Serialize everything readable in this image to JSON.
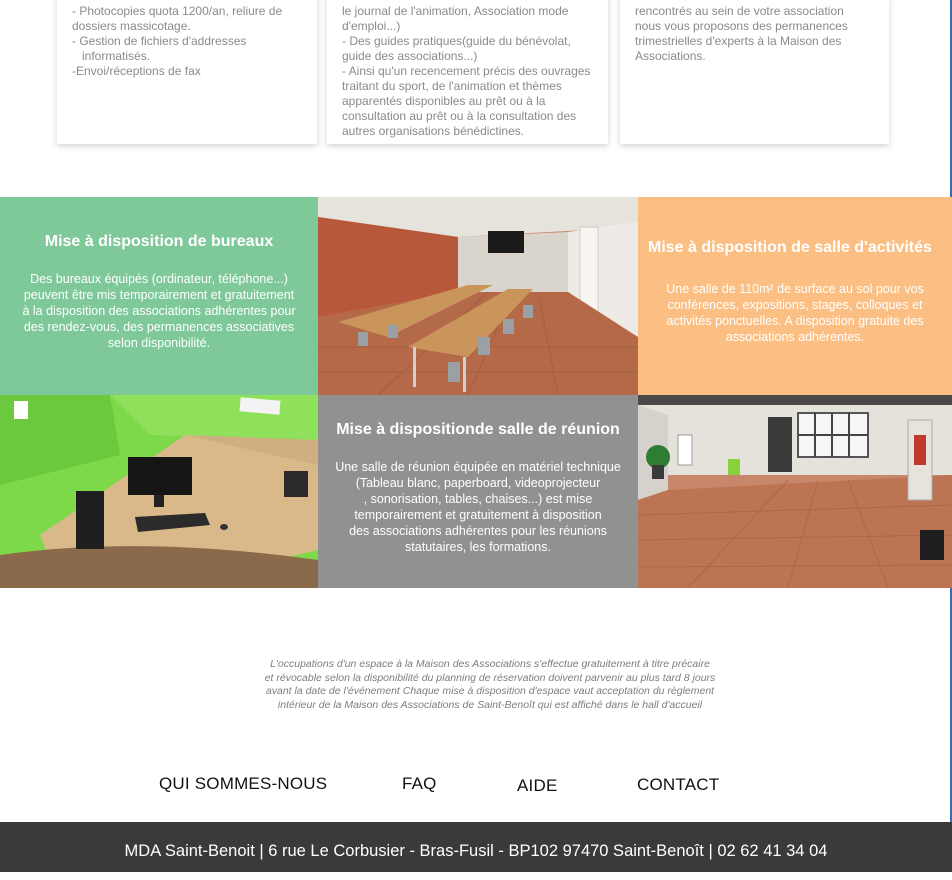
{
  "cards": [
    {
      "lines": [
        {
          "text": "- Photocopies quota 1200/an, reliure de",
          "indent": false
        },
        {
          "text": "dossiers massicotage.",
          "indent": false
        },
        {
          "text": "- Gestion de fichiers d'addresses",
          "indent": false
        },
        {
          "text": "informatisés.",
          "indent": true
        },
        {
          "text": "-Envoi/réceptions de fax",
          "indent": false
        }
      ]
    },
    {
      "lines": [
        {
          "text": "le journal de l'animation, Association mode",
          "indent": false
        },
        {
          "text": "d'emploi...)",
          "indent": false
        },
        {
          "text": "- Des guides pratiques(guide du bénévolat,",
          "indent": false
        },
        {
          "text": "guide des associations...)",
          "indent": false
        },
        {
          "text": "- Ainsi qu'un recencement précis des ouvrages",
          "indent": false
        },
        {
          "text": "traitant du sport, de l'animation et thèmes",
          "indent": false
        },
        {
          "text": "apparentés disponibles au prêt ou à la",
          "indent": false
        },
        {
          "text": "consultation au prêt ou à la consultation des",
          "indent": false
        },
        {
          "text": "autres organisations bénédictines.",
          "indent": false
        }
      ]
    },
    {
      "lines": [
        {
          "text": "rencontrés au sein de votre association",
          "indent": false
        },
        {
          "text": "nous vous proposons des permanences",
          "indent": false
        },
        {
          "text": "trimestrielles d'experts à la Maison  des",
          "indent": false
        },
        {
          "text": "Associations.",
          "indent": false
        }
      ]
    }
  ],
  "services": {
    "bureaux": {
      "title": "Mise à disposition de bureaux",
      "lines": [
        "Des bureaux équipés (ordinateur, téléphone...)",
        "peuvent être mis temporairement et gratuitement",
        "à la disposition des associations adhérentes pour",
        "des rendez-vous, des permanences associatives",
        "selon disponibilité."
      ]
    },
    "activites": {
      "title": "Mise à disposition de salle d'activités",
      "lines": [
        "Une salle de 110m² de surface au sol pour vos",
        "conférences, expositions, stages, colloques et",
        "activités ponctuelles. A disposition gratuite des",
        "associations adhérentes."
      ]
    },
    "reunion": {
      "title": "Mise à dispositionde salle de réunion",
      "lines": [
        "Une salle de réunion équipée en matériel technique",
        "(Tableau blanc, paperboard, videoprojecteur",
        ", sonorisation, tables, chaises...) est mise",
        "temporairement et gratuitement à disposition",
        "des associations adhérentes pour les réunions",
        "statutaires, les formations."
      ]
    }
  },
  "disclaimer": [
    "L'occupations d'un espace à la Maison des Associations s'effectue gratuitement à titre précaire",
    "et révocable selon la disponibilité du planning de réservation doivent parvenir au plus tard 8 jours",
    "avant la date de l'événement  Chaque mise à disposition d'espace vaut acceptation du règlement",
    "intérieur de la Maison des Associations de Saint-Benoît qui est affiché dans le hall d'accueil"
  ],
  "nav": {
    "qui": "QUI SOMMES-NOUS",
    "faq": "FAQ",
    "aide": "AIDE",
    "contact": "CONTACT"
  },
  "footer": {
    "text": "MDA Saint-Benoit | 6 rue Le Corbusier - Bras-Fusil - BP102 97470 Saint-Benoît | 02 62 41 34 04"
  },
  "colors": {
    "green_tile": "#7fc89a",
    "orange_tile": "#fbbf84",
    "grey_tile": "#919191",
    "footer_bg": "#3a3a3a"
  }
}
